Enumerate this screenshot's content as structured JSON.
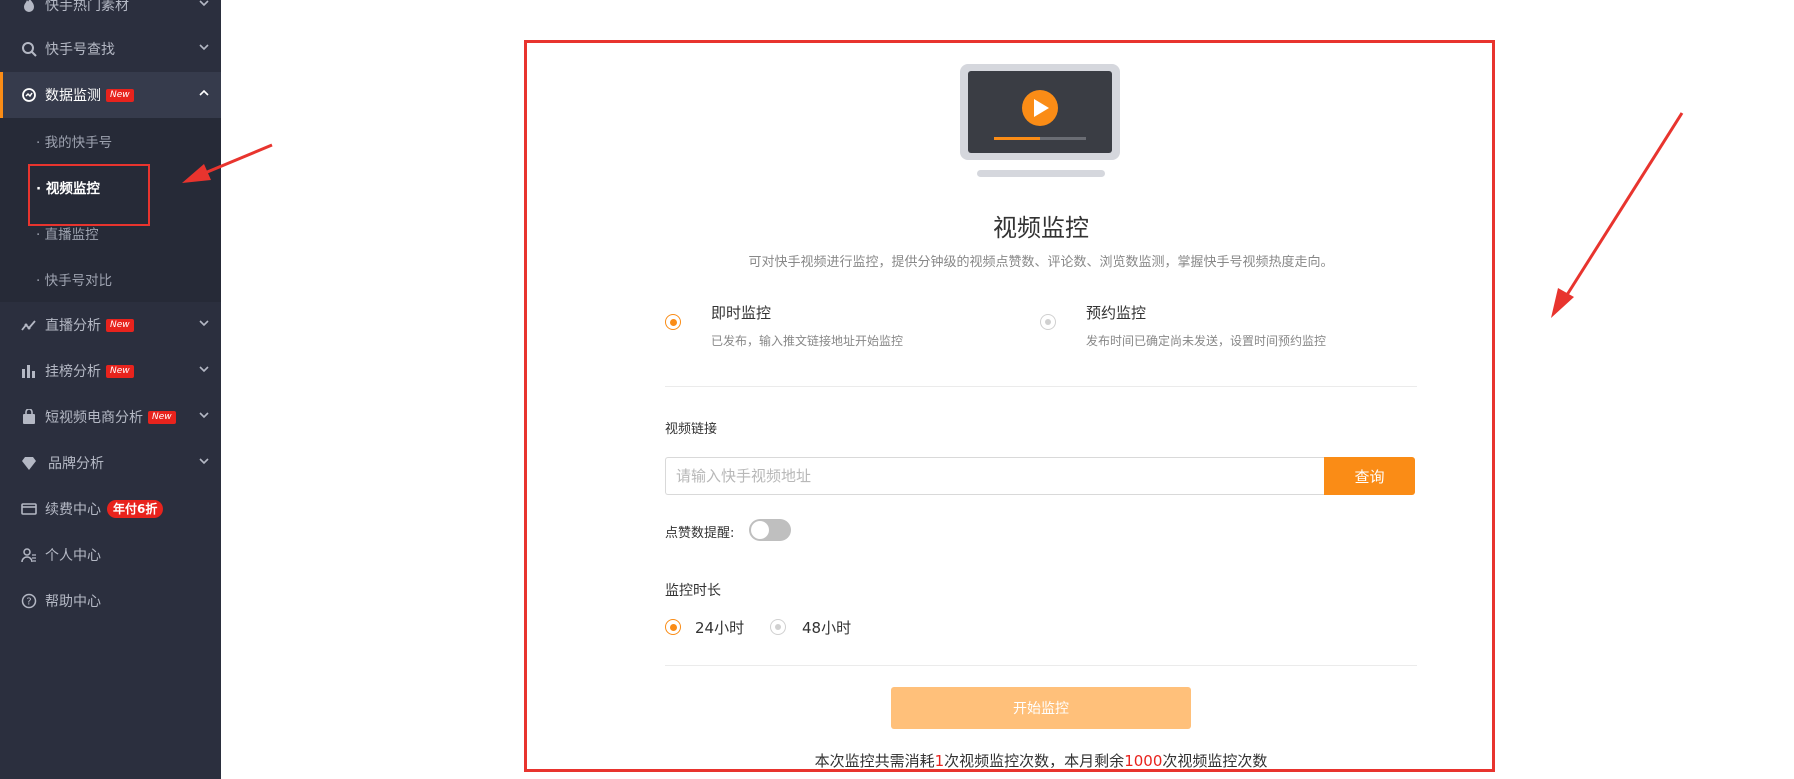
{
  "sidebar": {
    "top_item": "快手热门素材",
    "search_item": "快手号查找",
    "data_monitor": {
      "label": "数据监测",
      "badge": "New"
    },
    "sub_items": [
      "· 我的快手号",
      "· 视频监控",
      "· 直播监控",
      "· 快手号对比"
    ],
    "live_analysis": {
      "label": "直播分析",
      "badge": "New"
    },
    "rank_analysis": {
      "label": "挂榜分析",
      "badge": "New"
    },
    "ecommerce_analysis": {
      "label": "短视频电商分析",
      "badge": "New"
    },
    "brand_analysis": "品牌分析",
    "renewal": {
      "label": "续费中心",
      "badge": "年付6折"
    },
    "personal": "个人中心",
    "help": "帮助中心"
  },
  "main": {
    "title": "视频监控",
    "description": "可对快手视频进行监控，提供分钟级的视频点赞数、评论数、浏览数监测，掌握快手号视频热度走向。",
    "modes": [
      {
        "title": "即时监控",
        "desc": "已发布，输入推文链接地址开始监控",
        "selected": true
      },
      {
        "title": "预约监控",
        "desc": "发布时间已确定尚未发送，设置时间预约监控",
        "selected": false
      }
    ],
    "link_label": "视频链接",
    "link_placeholder": "请输入快手视频地址",
    "query_button": "查询",
    "like_alert_label": "点赞数提醒:",
    "duration_label": "监控时长",
    "durations": [
      {
        "label": "24小时",
        "selected": true
      },
      {
        "label": "48小时",
        "selected": false
      }
    ],
    "start_button": "开始监控",
    "footer": {
      "part1": "本次监控共需消耗",
      "cost": "1",
      "part2": "次视频监控次数，本月剩余",
      "remaining": "1000",
      "part3": "次视频监控次数"
    }
  },
  "colors": {
    "accent": "#fa8c16",
    "annotation_red": "#e8342e",
    "sidebar_bg": "#2b2f3e"
  }
}
